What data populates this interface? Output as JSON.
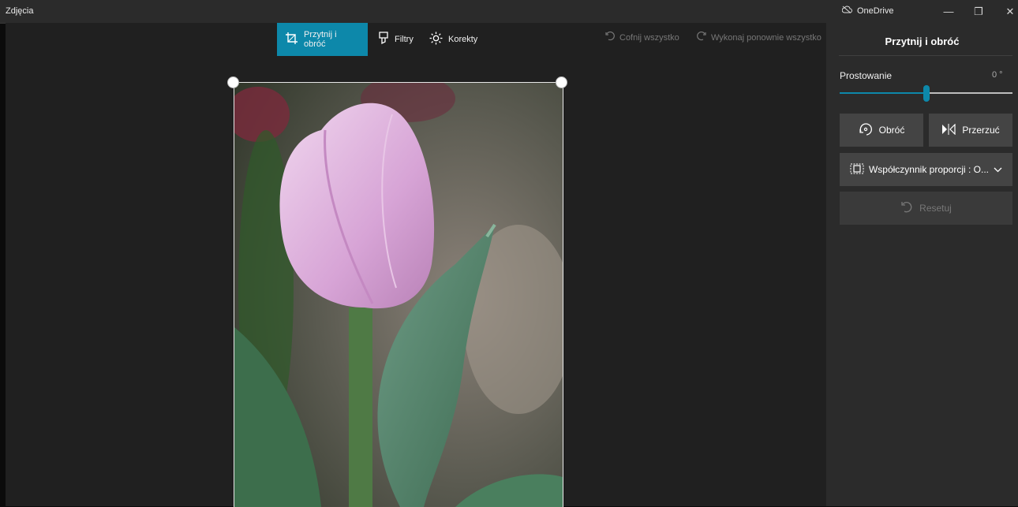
{
  "titlebar": {
    "title": "Zdjęcia",
    "onedrive_label": "OneDrive",
    "min_glyph": "—",
    "restore_glyph": "❐",
    "close_glyph": "✕"
  },
  "toolbar": {
    "tabs": [
      {
        "label": "Przytnij i obróć",
        "icon": "crop-icon",
        "active": true
      },
      {
        "label": "Filtry",
        "icon": "filter-icon",
        "active": false
      },
      {
        "label": "Korekty",
        "icon": "brightness-icon",
        "active": false
      }
    ],
    "undo_all": "Cofnij wszystko",
    "redo_all": "Wykonaj ponownie wszystko"
  },
  "panel": {
    "title": "Przytnij i obróć",
    "straighten_label": "Prostowanie",
    "straighten_value": "0 °",
    "straighten_level": 0.5,
    "rotate_label": "Obróć",
    "flip_label": "Przerzuć",
    "aspect_label": "Współczynnik proporcji : O...",
    "reset_label": "Resetuj"
  },
  "colors": {
    "accent": "#0d88aa",
    "panel_bg": "#2b2b2b",
    "canvas_bg": "#202020"
  }
}
